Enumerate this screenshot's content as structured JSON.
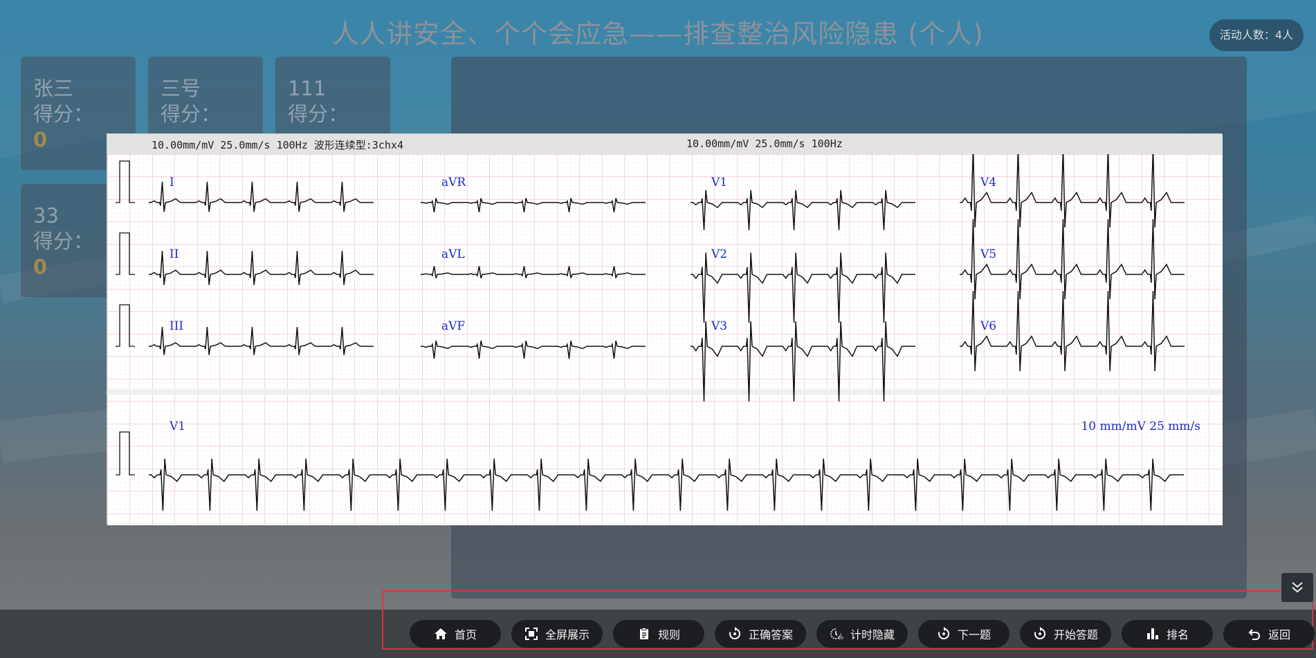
{
  "title": "人人讲安全、个个会应急——排查整治风险隐患 (个人)",
  "active_count": "活动人数：4人",
  "players": [
    {
      "name": "张三",
      "score_label": "得分：",
      "score": "0"
    },
    {
      "name": "三号",
      "score_label": "得分：",
      "score": ""
    },
    {
      "name": "111",
      "score_label": "得分：",
      "score": ""
    },
    {
      "name": "33",
      "score_label": "得分：",
      "score": "0"
    }
  ],
  "ecg": {
    "header_left": "10.00mm/mV 25.0mm/s 100Hz 波形连续型:3chx4",
    "header_right": "10.00mm/mV 25.0mm/s 100Hz",
    "lead_labels": [
      "I",
      "aVR",
      "V1",
      "V4",
      "II",
      "aVL",
      "V2",
      "V5",
      "III",
      "aVF",
      "V3",
      "V6"
    ],
    "rhythm_label": "V1",
    "rhythm_scale": "10 mm/mV   25 mm/s",
    "grid_minor_color": "#f3c9d2",
    "grid_major_color": "#e79aab",
    "label_color": "#1a2bc8"
  },
  "toolbar": [
    {
      "icon": "home-icon",
      "label": "首页"
    },
    {
      "icon": "fullscreen-icon",
      "label": "全屏展示"
    },
    {
      "icon": "rules-icon",
      "label": "规则"
    },
    {
      "icon": "answer-icon",
      "label": "正确答案"
    },
    {
      "icon": "timer-hide-icon",
      "label": "计时隐藏"
    },
    {
      "icon": "next-icon",
      "label": "下一题"
    },
    {
      "icon": "start-icon",
      "label": "开始答题"
    },
    {
      "icon": "ranking-icon",
      "label": "排名"
    },
    {
      "icon": "back-icon",
      "label": "返回"
    }
  ],
  "collapse_icon": "double-chevron-down-icon"
}
